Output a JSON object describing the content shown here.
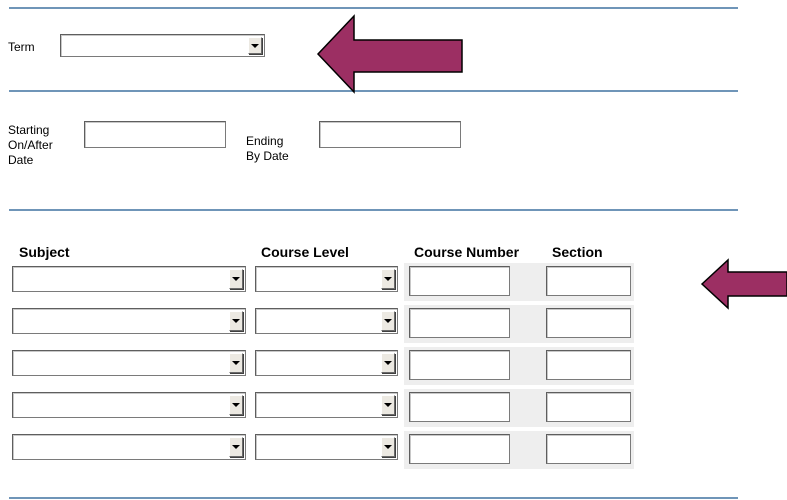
{
  "term": {
    "label": "Term",
    "selected": ""
  },
  "dates": {
    "start_label_lines": [
      "Starting",
      "On/After",
      "Date"
    ],
    "start_value": "",
    "end_label_lines": [
      "Ending",
      "By Date"
    ],
    "end_value": ""
  },
  "table": {
    "headers": [
      "Subject",
      "Course Level",
      "Course Number",
      "Section"
    ],
    "rows": [
      {
        "subject": "",
        "level": "",
        "number": "",
        "section": ""
      },
      {
        "subject": "",
        "level": "",
        "number": "",
        "section": ""
      },
      {
        "subject": "",
        "level": "",
        "number": "",
        "section": ""
      },
      {
        "subject": "",
        "level": "",
        "number": "",
        "section": ""
      },
      {
        "subject": "",
        "level": "",
        "number": "",
        "section": ""
      }
    ]
  },
  "colors": {
    "rule": "#6f95b8",
    "arrow_fill": "#9c2f63",
    "arrow_stroke": "#000000"
  },
  "icons": [
    "chevron-down-icon",
    "left-arrow-annotation"
  ]
}
